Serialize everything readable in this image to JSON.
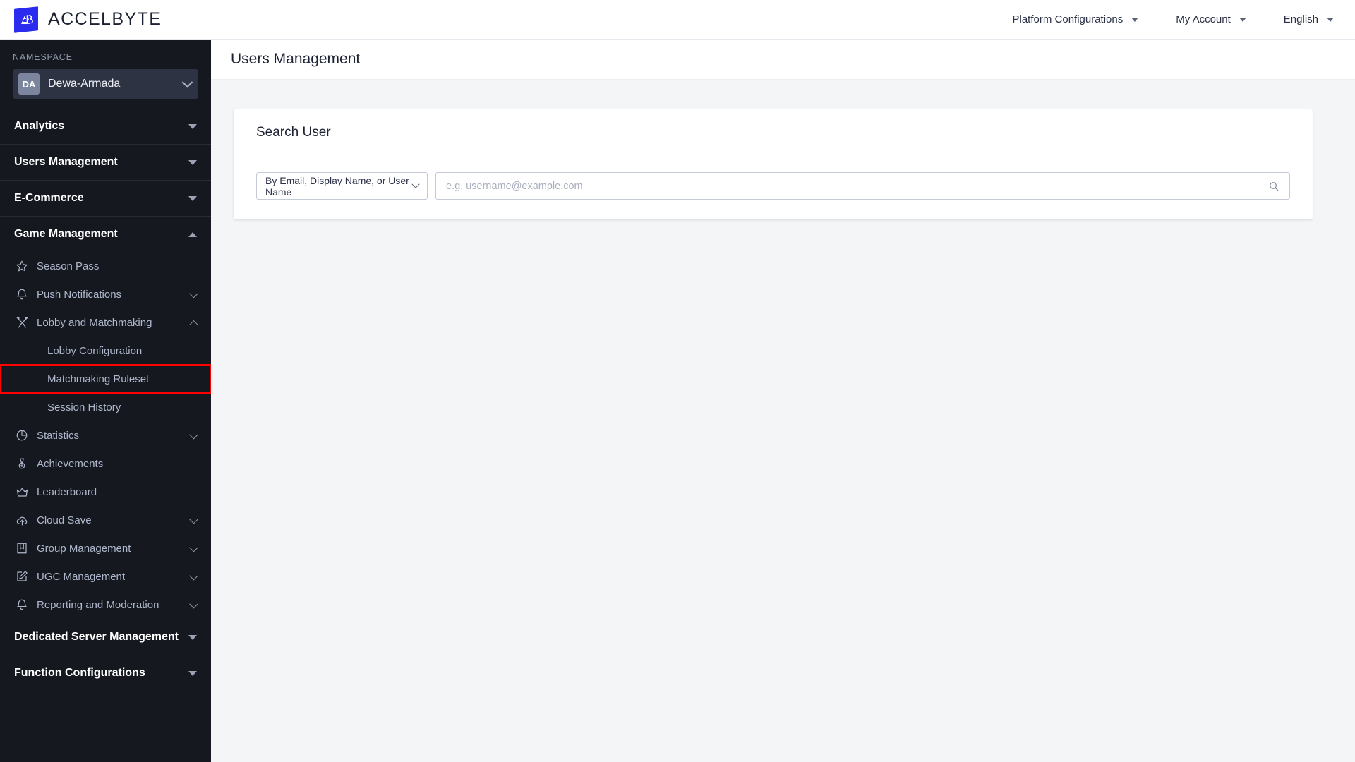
{
  "topbar": {
    "logo_icon": "accelbyte-logo-icon",
    "brand_first": "ACCEL",
    "brand_second": "BYTE",
    "brand_accent_color": "#2b2bf0",
    "nav": [
      {
        "label": "Platform Configurations",
        "icon": "chevron-down-icon"
      },
      {
        "label": "My Account",
        "icon": "chevron-down-icon"
      },
      {
        "label": "English",
        "icon": "chevron-down-icon"
      }
    ]
  },
  "sidebar": {
    "namespace_label": "NAMESPACE",
    "namespace_initials": "DA",
    "namespace_name": "Dewa-Armada",
    "sections": [
      {
        "label": "Analytics",
        "state": "collapsed"
      },
      {
        "label": "Users Management",
        "state": "collapsed"
      },
      {
        "label": "E-Commerce",
        "state": "collapsed"
      },
      {
        "label": "Game Management",
        "state": "expanded"
      }
    ],
    "game_management_items": [
      {
        "label": "Season Pass",
        "icon": "star-icon",
        "expandable": false
      },
      {
        "label": "Push Notifications",
        "icon": "bell-icon",
        "expandable": true,
        "state": "collapsed"
      },
      {
        "label": "Lobby and Matchmaking",
        "icon": "crossed-swords-icon",
        "expandable": true,
        "state": "expanded"
      }
    ],
    "lobby_sub_items": [
      {
        "label": "Lobby Configuration",
        "highlighted": false
      },
      {
        "label": "Matchmaking Ruleset",
        "highlighted": true
      },
      {
        "label": "Session History",
        "highlighted": false
      }
    ],
    "game_management_items_rest": [
      {
        "label": "Statistics",
        "icon": "pie-chart-icon",
        "expandable": true
      },
      {
        "label": "Achievements",
        "icon": "medal-icon",
        "expandable": false
      },
      {
        "label": "Leaderboard",
        "icon": "crown-icon",
        "expandable": false
      },
      {
        "label": "Cloud Save",
        "icon": "cloud-upload-icon",
        "expandable": true
      },
      {
        "label": "Group Management",
        "icon": "group-banner-icon",
        "expandable": true
      },
      {
        "label": "UGC Management",
        "icon": "edit-square-icon",
        "expandable": true
      },
      {
        "label": "Reporting and Moderation",
        "icon": "bell-icon",
        "expandable": true
      }
    ],
    "bottom_sections": [
      {
        "label": "Dedicated Server Management",
        "state": "collapsed"
      },
      {
        "label": "Function Configurations",
        "state": "collapsed"
      }
    ],
    "highlight_color": "#ff0000"
  },
  "main": {
    "page_title": "Users Management",
    "card": {
      "title": "Search User",
      "filter_value": "By Email, Display Name, or User Name",
      "filter_icon": "chevron-down-icon",
      "search_placeholder": "e.g. username@example.com",
      "search_value": "",
      "search_icon": "search-icon"
    }
  }
}
